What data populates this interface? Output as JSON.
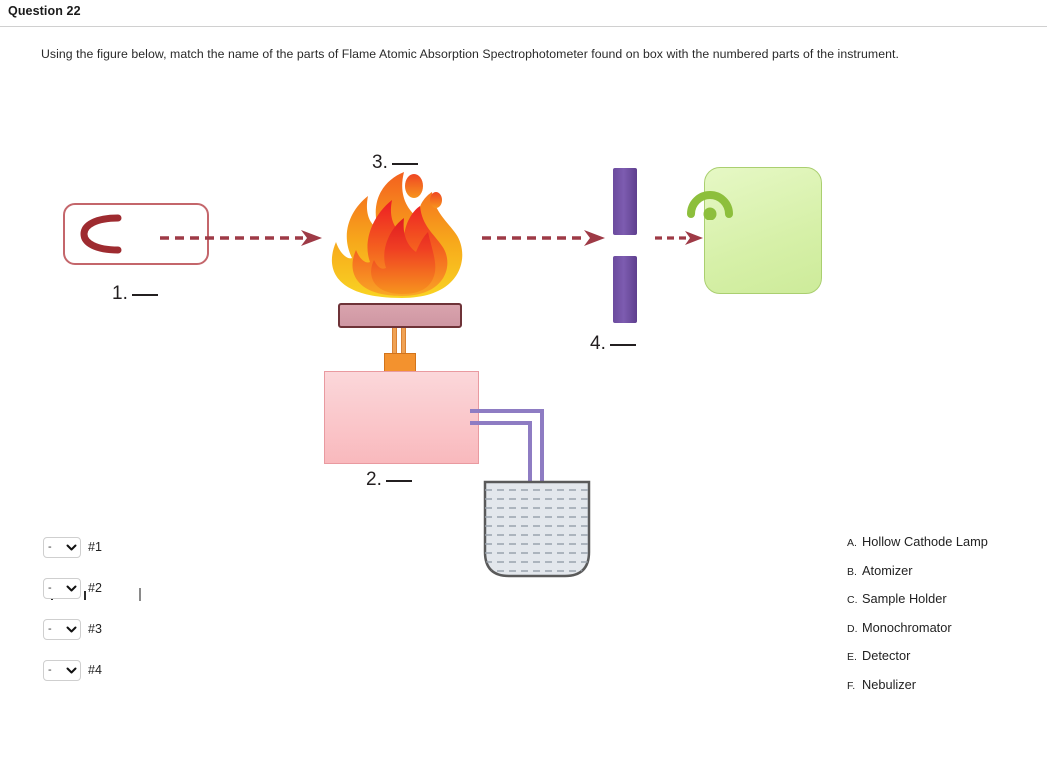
{
  "header": {
    "question_title": "Question 22"
  },
  "prompt": {
    "text": "Using the figure below, match the name of the parts of Flame Atomic Absorption Spectrophotometer found on box with the numbered parts of the instrument."
  },
  "diagram": {
    "labels": [
      {
        "id": "1",
        "number": "1.",
        "component": "hollow-cathode-lamp"
      },
      {
        "id": "2",
        "number": "2.",
        "component": "nebulizer-chamber"
      },
      {
        "id": "3",
        "number": "3.",
        "component": "flame-atomizer"
      },
      {
        "id": "4",
        "number": "4.",
        "component": "monochromator-slit"
      }
    ],
    "colors": {
      "lamp_outline": "#c4666b",
      "cathode": "#9e2b30",
      "arrow": "#9e3a46",
      "flame_outer": "#f7a81b",
      "flame_mid": "#f4601f",
      "flame_inner": "#ed1c24",
      "burner_head": "#d9a3ad",
      "burner_border": "#6e3338",
      "burner_tube": "#f0a254",
      "connector": "#f3922e",
      "nebulizer_chamber": "#f9b9bd",
      "tubing": "#8e7cc3",
      "beaker_fill": "#dfe3e8",
      "beaker_border": "#5a5a5a",
      "monochromator": "#6b4b9e",
      "detector_fill": "#d6f0a8",
      "detector_border": "#aacf70",
      "detector_sensor": "#8dbf3c"
    }
  },
  "answers": {
    "dropdowns": [
      {
        "value": "-",
        "label": "#1"
      },
      {
        "value": "-",
        "label": "#2"
      },
      {
        "value": "-",
        "label": "#3"
      },
      {
        "value": "-",
        "label": "#4"
      }
    ],
    "options": [
      {
        "letter": "A.",
        "text": "Hollow Cathode Lamp"
      },
      {
        "letter": "B.",
        "text": "Atomizer"
      },
      {
        "letter": "C.",
        "text": "Sample Holder"
      },
      {
        "letter": "D.",
        "text": "Monochromator"
      },
      {
        "letter": "E.",
        "text": "Detector"
      },
      {
        "letter": "F.",
        "text": "Nebulizer"
      }
    ]
  }
}
